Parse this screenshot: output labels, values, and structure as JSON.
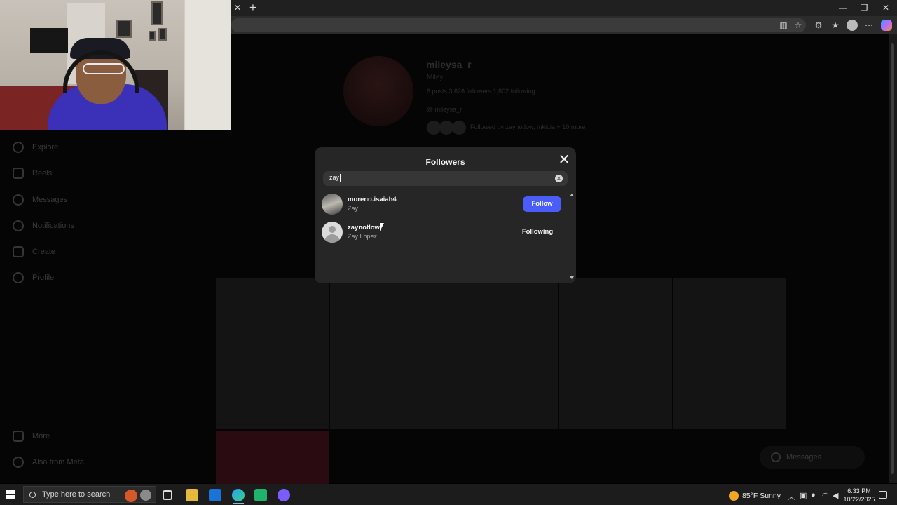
{
  "browser": {
    "tab_close_glyph": "✕",
    "new_tab_glyph": "+",
    "window": {
      "minimize": "—",
      "restore": "❐",
      "close": "✕"
    },
    "toolbar_icons": [
      "split-screen-icon",
      "favorites-star-icon",
      "extensions-icon",
      "collections-icon",
      "profile-icon",
      "more-icon",
      "copilot-icon"
    ]
  },
  "profile": {
    "username": "mileysa_r",
    "name": "Miley",
    "stats": "6 posts   3,626 followers   1,802 following",
    "link": "@ mileysa_r",
    "followed_by": "Followed by zaynotlow, mkittia + 10 more"
  },
  "sidebar": {
    "items": [
      {
        "label": "Explore",
        "icon": "compass-icon"
      },
      {
        "label": "Reels",
        "icon": "reels-icon"
      },
      {
        "label": "Messages",
        "icon": "messenger-icon"
      },
      {
        "label": "Notifications",
        "icon": "heart-icon"
      },
      {
        "label": "Create",
        "icon": "plus-square-icon"
      },
      {
        "label": "Profile",
        "icon": "avatar-icon"
      },
      {
        "label": "More",
        "icon": "menu-icon"
      },
      {
        "label": "Also from Meta",
        "icon": "meta-icon"
      }
    ]
  },
  "messages_pill": {
    "label": "Messages"
  },
  "modal": {
    "title": "Followers",
    "close_glyph": "✕",
    "search": {
      "value": "zay",
      "clear_glyph": "✕"
    },
    "results": [
      {
        "username": "moreno.isaiah4",
        "full_name": "Zay",
        "action": "Follow"
      },
      {
        "username": "zaynotlow",
        "full_name": "Zay Lopez",
        "action": "Following"
      }
    ]
  },
  "taskbar": {
    "search_placeholder": "Type here to search",
    "weather": "85°F  Sunny",
    "time": "6:33 PM",
    "date": "10/22/2025",
    "colors": {
      "accent": "#4a5df9"
    }
  }
}
